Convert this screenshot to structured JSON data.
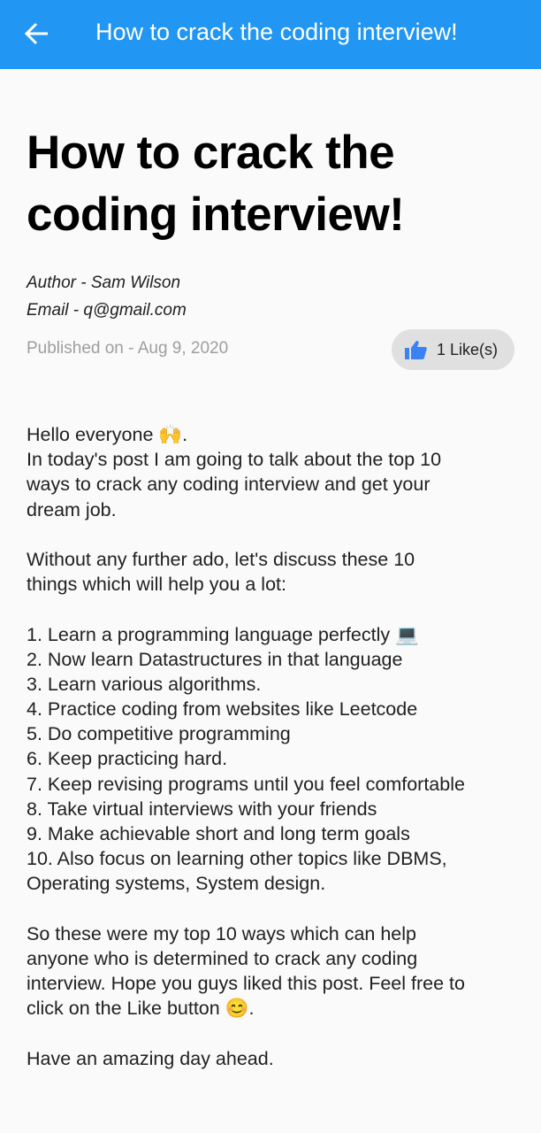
{
  "appbar": {
    "title": "How to crack the coding interview!",
    "back_icon": "arrow-left-icon",
    "color": "#2196F3"
  },
  "post": {
    "title_lines": [
      "How to crack the",
      "coding interview!"
    ],
    "author": "Author - Sam Wilson",
    "email": "Email - q@gmail.com",
    "published": "Published on - Aug 9, 2020",
    "likes_label": "1 Like(s)",
    "like_icon": "thumbs-up-icon",
    "body_lines": [
      "Hello everyone 🙌.",
      "In today's post I am going to talk about the top 10",
      "ways to crack any coding interview and get your",
      "dream job.",
      "",
      "Without any further ado, let's discuss these 10",
      "things which will help you a lot:",
      "",
      "1. Learn a programming language perfectly 💻",
      "2. Now learn Datastructures in that language",
      "3. Learn various algorithms.",
      "4. Practice coding from websites like Leetcode",
      "5. Do competitive programming",
      "6. Keep practicing hard.",
      "7. Keep revising programs until you feel comfortable",
      "8. Take virtual interviews with your friends",
      "9. Make achievable short and long term goals",
      "10. Also focus on learning other topics like DBMS,",
      "Operating systems, System design.",
      "",
      "So these were my top 10 ways which can help",
      "anyone who is determined to crack any coding",
      "interview. Hope you guys liked this post. Feel free to",
      "click on the Like button 😊.",
      "",
      "Have an amazing day ahead."
    ]
  }
}
